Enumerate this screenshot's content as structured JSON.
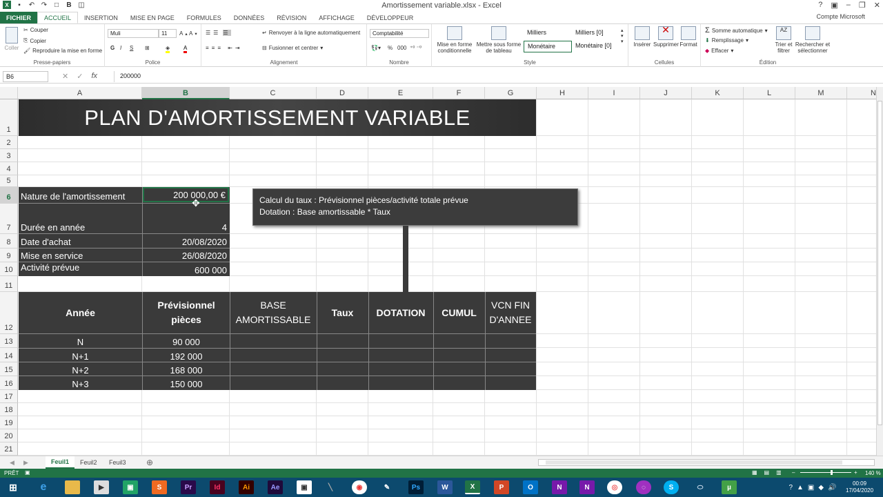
{
  "window": {
    "title": "Amortissement variable.xlsx - Excel",
    "account": "Compte Microsoft"
  },
  "ribbon_tabs": [
    "FICHIER",
    "ACCUEIL",
    "INSERTION",
    "MISE EN PAGE",
    "FORMULES",
    "DONNÉES",
    "RÉVISION",
    "AFFICHAGE",
    "DÉVELOPPEUR"
  ],
  "clipboard": {
    "paste": "Coller",
    "cut": "Couper",
    "copy": "Copier",
    "format_painter": "Reproduire la mise en forme",
    "label": "Presse-papiers"
  },
  "font": {
    "name": "Muli",
    "size": "11",
    "label": "Police",
    "bold": "G",
    "italic": "I",
    "underline": "S"
  },
  "alignment": {
    "wrap": "Renvoyer à la ligne automatiquement",
    "merge": "Fusionner et centrer",
    "label": "Alignement"
  },
  "number": {
    "format": "Comptabilité",
    "label": "Nombre",
    "percent": "%",
    "thousands": "000"
  },
  "styles": {
    "cond": "Mise en forme conditionnelle",
    "table": "Mettre sous forme de tableau",
    "s1": "Milliers",
    "s2": "Milliers [0]",
    "s3": "Monétaire",
    "s4": "Monétaire [0]",
    "label": "Style"
  },
  "cells": {
    "insert": "Insérer",
    "delete": "Supprimer",
    "format": "Format",
    "label": "Cellules"
  },
  "editing": {
    "autosum": "Somme automatique",
    "fill": "Remplissage",
    "clear": "Effacer",
    "sort": "Trier et filtrer",
    "find": "Rechercher et sélectionner",
    "label": "Édition"
  },
  "formula_bar": {
    "namebox": "B6",
    "content": "200000"
  },
  "columns": [
    "A",
    "B",
    "C",
    "D",
    "E",
    "F",
    "G",
    "H",
    "I",
    "J",
    "K",
    "L",
    "M",
    "N"
  ],
  "rows": [
    "1",
    "2",
    "3",
    "4",
    "5",
    "6",
    "7",
    "8",
    "9",
    "10",
    "11",
    "12",
    "13",
    "14",
    "15",
    "16",
    "17",
    "18",
    "19",
    "20",
    "21"
  ],
  "sheet": {
    "title": "PLAN D'AMORTISSEMENT VARIABLE",
    "info": [
      {
        "label": "Nature de l'amortissement",
        "value": "200 000,00 €"
      },
      {
        "label": "Durée en année",
        "value": "4"
      },
      {
        "label": "Date d'achat",
        "value": "20/08/2020"
      },
      {
        "label": "Mise en service",
        "value": "26/08/2020"
      },
      {
        "label": "Activité prévue",
        "value": "600 000"
      }
    ],
    "comment_line1": "Calcul du taux : Prévisionnel pièces/activité totale prévue",
    "comment_line2": "Dotation : Base amortissable * Taux",
    "table_headers": [
      "Année",
      "Prévisionnel pièces",
      "BASE AMORTISSABLE",
      "Taux",
      "DOTATION",
      "CUMUL",
      "VCN FIN D'ANNEE"
    ],
    "table_rows": [
      {
        "year": "N",
        "pieces": "90 000"
      },
      {
        "year": "N+1",
        "pieces": "192 000"
      },
      {
        "year": "N+2",
        "pieces": "168 000"
      },
      {
        "year": "N+3",
        "pieces": "150 000"
      }
    ]
  },
  "sheet_tabs": [
    "Feuil1",
    "Feuil2",
    "Feuil3"
  ],
  "status": {
    "ready": "PRÊT",
    "zoom": "140 %"
  },
  "clock": {
    "time": "00:09",
    "date": "17/04/2020"
  }
}
